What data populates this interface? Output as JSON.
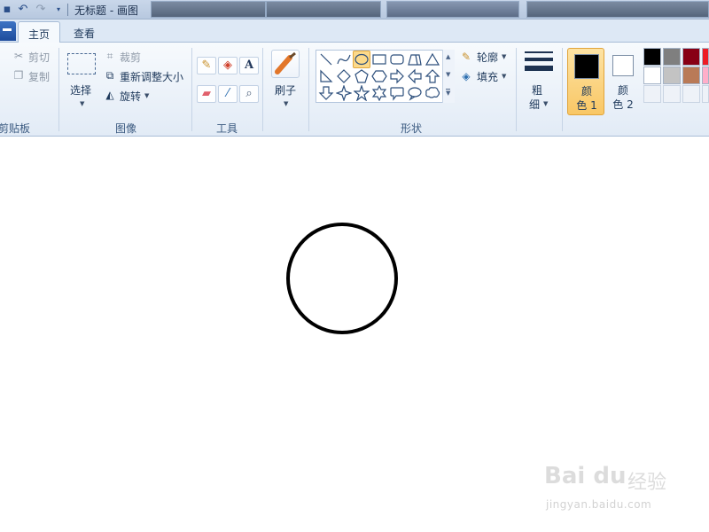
{
  "app": {
    "title": "无标题 - 画图",
    "quick_access_icons": [
      "save-icon",
      "undo-icon",
      "redo-icon",
      "customize-qat-icon"
    ]
  },
  "tabs": [
    {
      "label": "主页",
      "active": true
    },
    {
      "label": "查看",
      "active": false
    }
  ],
  "clipboard": {
    "cut_label": "剪切",
    "copy_label": "复制",
    "group_label": "剪贴板"
  },
  "image": {
    "select_label": "选择",
    "crop_label": "裁剪",
    "resize_label": "重新调整大小",
    "rotate_label": "旋转",
    "group_label": "图像"
  },
  "tools": {
    "items": [
      "pencil-icon",
      "fill-bucket-icon",
      "text-icon",
      "eraser-icon",
      "color-picker-icon",
      "magnifier-icon"
    ],
    "group_label": "工具"
  },
  "brushes": {
    "label": "刷子"
  },
  "shapes": {
    "outline_label": "轮廓",
    "fill_label": "填充",
    "group_label": "形状",
    "selected": "oval",
    "items": [
      "line",
      "curve",
      "oval",
      "rectangle",
      "rounded-rectangle",
      "polygon",
      "triangle",
      "right-triangle",
      "diamond",
      "pentagon",
      "hexagon",
      "right-arrow",
      "left-arrow",
      "up-arrow",
      "down-arrow",
      "four-point-star",
      "five-point-star",
      "six-point-star",
      "rounded-callout",
      "oval-callout",
      "cloud-callout"
    ]
  },
  "size": {
    "label_line1": "粗",
    "label_line2": "细"
  },
  "colors": {
    "color1_line1": "颜",
    "color1_line2": "色 1",
    "color2_line1": "颜",
    "color2_line2": "色 2",
    "color1_value": "#000000",
    "color2_value": "#ffffff",
    "palette": [
      "#000000",
      "#7f7f7f",
      "#880015",
      "#ed1c24",
      "#ffffff",
      "#c3c3c3",
      "#b97a57",
      "#ffaec9",
      "",
      "",
      "",
      ""
    ]
  },
  "canvas": {
    "shape": "circle",
    "stroke_color": "#000000"
  },
  "watermark": {
    "logo": "Bai du",
    "cn": "经验",
    "url": "jingyan.baidu.com"
  }
}
